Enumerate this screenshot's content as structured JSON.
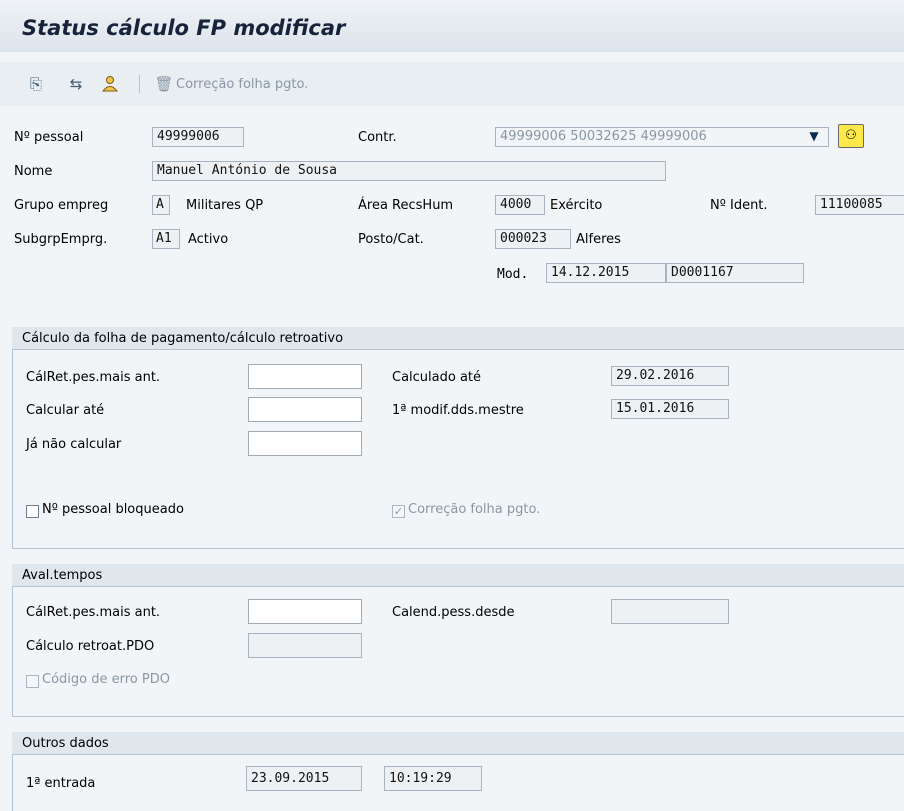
{
  "window": {
    "title": "Status cálculo FP modificar"
  },
  "toolbar": {
    "correcao_label": "Correção folha pgto."
  },
  "header": {
    "pessoal_label": "Nº pessoal",
    "pessoal_value": "49999006",
    "contr_label": "Contr.",
    "contr_value": "49999006 50032625 49999006",
    "nome_label": "Nome",
    "nome_value": "Manuel António de Sousa",
    "grupo_label": "Grupo empreg",
    "grupo_code": "A",
    "grupo_text": "Militares QP",
    "area_label": "Área RecsHum",
    "area_code": "4000",
    "area_text": "Exército",
    "ident_label": "Nº Ident.",
    "ident_value": "11100085",
    "subgrp_label": "SubgrpEmprg.",
    "subgrp_code": "A1",
    "subgrp_text": "Activo",
    "posto_label": "Posto/Cat.",
    "posto_code": "000023",
    "posto_text": "Alferes",
    "mod_label": "Mod.",
    "mod_date": "14.12.2015",
    "mod_user": "D0001167"
  },
  "payroll": {
    "title": "Cálculo da folha de pagamento/cálculo retroativo",
    "calret_label": "CálRet.pes.mais ant.",
    "calret_value": "",
    "calcular_label": "Calcular até",
    "calcular_value": "",
    "janao_label": "Já não calcular",
    "janao_value": "",
    "calculado_label": "Calculado até",
    "calculado_value": "29.02.2016",
    "primeira_label": "1ª modif.dds.mestre",
    "primeira_value": "15.01.2016",
    "bloqueado_label": "Nº pessoal bloqueado",
    "bloqueado_checked": false,
    "correcao_label": "Correção folha pgto.",
    "correcao_checked": true
  },
  "aval": {
    "title": "Aval.tempos",
    "calret_label": "CálRet.pes.mais ant.",
    "calret_value": "",
    "pdo_label": "Cálculo retroat.PDO",
    "pdo_value": "",
    "calend_label": "Calend.pess.desde",
    "calend_value": "",
    "erro_label": "Código de erro PDO",
    "erro_checked": false
  },
  "outros": {
    "title": "Outros dados",
    "entrada_label": "1ª entrada",
    "entrada_date": "23.09.2015",
    "entrada_time": "10:19:29"
  }
}
